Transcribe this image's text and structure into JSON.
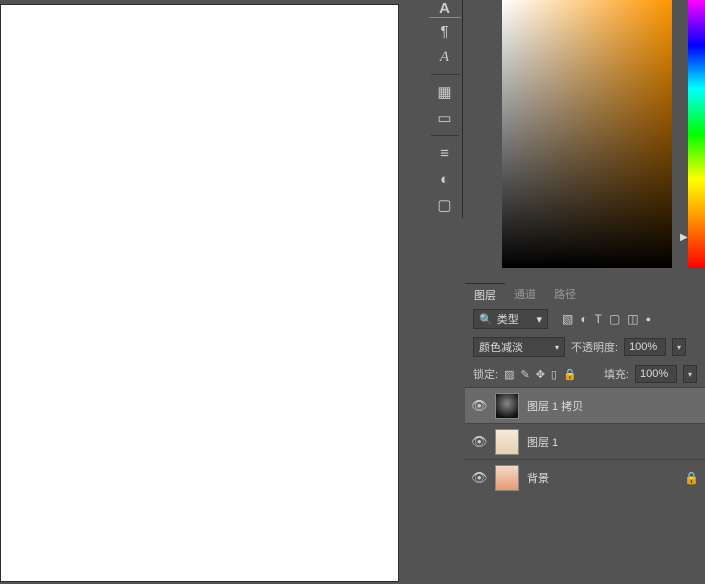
{
  "tools": {
    "items": [
      "A",
      "¶",
      "A",
      "▦",
      "▭",
      "≡",
      "◐",
      "▢"
    ]
  },
  "panel": {
    "tabs": [
      "图层",
      "通道",
      "路径"
    ],
    "active_tab": 0,
    "type_label": "类型",
    "type_icons": [
      "▧",
      "◐",
      "T",
      "▢",
      "◫",
      "●"
    ],
    "blend_mode": "颜色减淡",
    "opacity_label": "不透明度:",
    "opacity_value": "100%",
    "lock_label": "锁定:",
    "lock_icons": [
      "▨",
      "✎",
      "✥",
      "▯",
      "🔒"
    ],
    "fill_label": "填充:",
    "fill_value": "100%",
    "layers": [
      {
        "name": "图层 1 拷贝",
        "visible": true,
        "selected": true,
        "thumb": "dark",
        "locked": false
      },
      {
        "name": "图层 1",
        "visible": true,
        "selected": false,
        "thumb": "light",
        "locked": false
      },
      {
        "name": "背景",
        "visible": true,
        "selected": false,
        "thumb": "photo",
        "locked": true
      }
    ]
  }
}
